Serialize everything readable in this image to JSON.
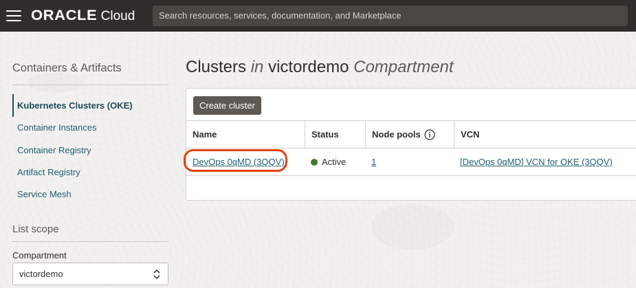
{
  "topbar": {
    "brand_oracle": "ORACLE",
    "brand_cloud": "Cloud",
    "search_placeholder": "Search resources, services, documentation, and Marketplace",
    "menu_icon": "hamburger-menu-icon"
  },
  "sidebar": {
    "title": "Containers & Artifacts",
    "items": [
      {
        "label": "Kubernetes Clusters (OKE)",
        "active": true
      },
      {
        "label": "Container Instances",
        "active": false
      },
      {
        "label": "Container Registry",
        "active": false
      },
      {
        "label": "Artifact Registry",
        "active": false
      },
      {
        "label": "Service Mesh",
        "active": false
      }
    ],
    "scope_title": "List scope",
    "compartment_label": "Compartment",
    "compartment_value": "victordemo"
  },
  "main": {
    "title_prefix": "Clusters",
    "title_in": "in",
    "title_compartment": "victordemo",
    "title_suffix": "Compartment",
    "create_button": "Create cluster",
    "table": {
      "headers": [
        "Name",
        "Status",
        "Node pools",
        "VCN"
      ],
      "rows": [
        {
          "name": "DevOps 0qMD (3QQV)",
          "status": "Active",
          "node_pools": "1",
          "vcn": "[DevOps 0qMD] VCN for OKE (3QQV)"
        }
      ]
    }
  },
  "colors": {
    "topbar_bg": "#312d2a",
    "link": "#1e5e74",
    "status_active": "#3d7b2f",
    "highlight_ring": "#e2410f",
    "button_bg": "#5e5955"
  }
}
